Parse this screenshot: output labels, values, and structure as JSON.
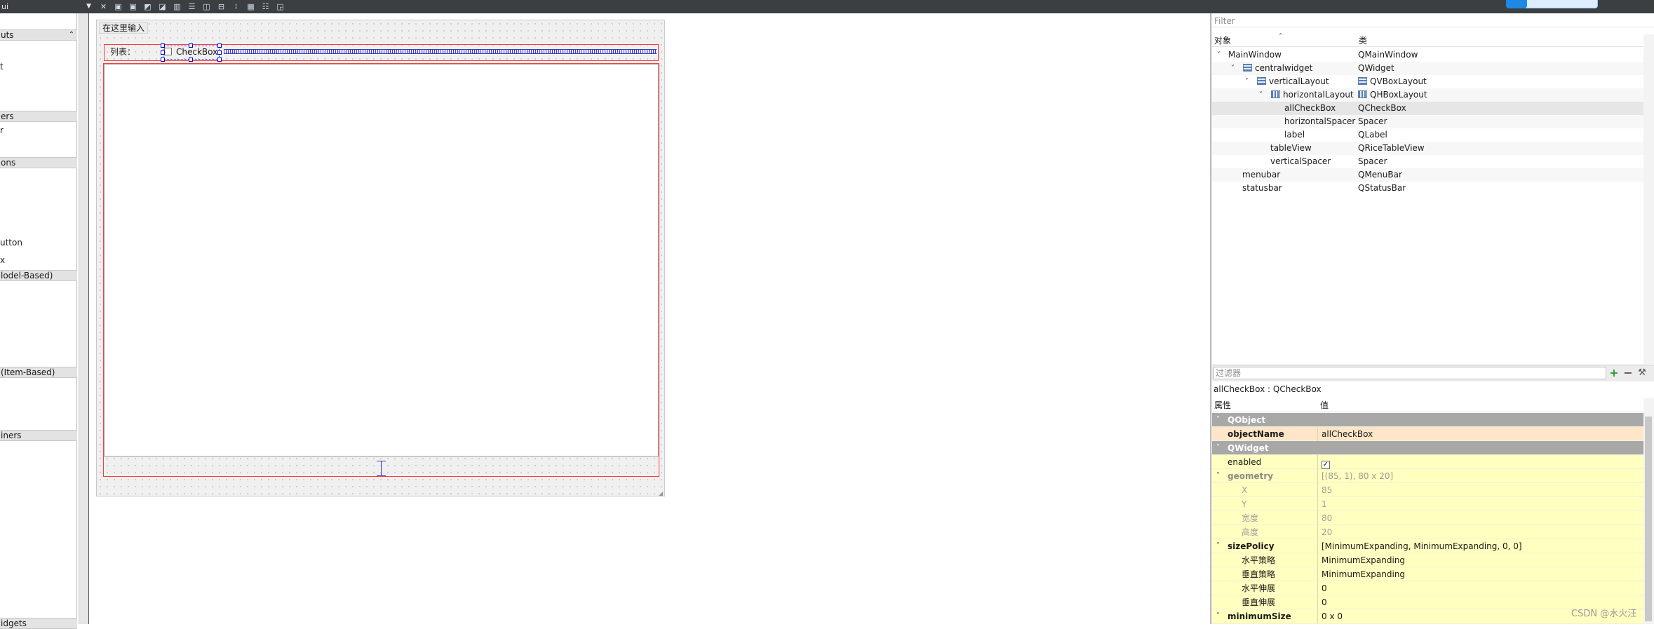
{
  "toolbar": {
    "combo_value": "ui",
    "icons": [
      "close-icon",
      "send-backward-icon",
      "bring-forward-icon",
      "edit-tab-order-icon",
      "edit-buddies-icon",
      "layout-horizontal-icon",
      "layout-vertical-icon",
      "layout-horizontal-splitter-icon",
      "layout-vertical-splitter-icon",
      "layout-grid-icon",
      "layout-form-icon",
      "break-layout-icon",
      "adjust-size-icon"
    ]
  },
  "widget_box": {
    "categories": [
      {
        "label": "uts"
      },
      {
        "label": "ers"
      },
      {
        "label": "ons"
      },
      {
        "label": "lodel-Based)"
      },
      {
        "label": "(Item-Based)"
      },
      {
        "label": "iners"
      },
      {
        "label": "idgets"
      }
    ],
    "items": [
      "t",
      "r",
      "utton",
      "x"
    ]
  },
  "form": {
    "menu_placeholder": "在这里输入",
    "label_text": "列表：",
    "checkbox_text": "CheckBox"
  },
  "object_inspector": {
    "filter_placeholder": "Filter",
    "col_object": "对象",
    "col_class": "类",
    "rows": [
      {
        "name": "MainWindow",
        "cls": "QMainWindow"
      },
      {
        "name": "centralwidget",
        "cls": "QWidget"
      },
      {
        "name": "verticalLayout",
        "cls": "QVBoxLayout"
      },
      {
        "name": "horizontalLayout",
        "cls": "QHBoxLayout"
      },
      {
        "name": "allCheckBox",
        "cls": "QCheckBox"
      },
      {
        "name": "horizontalSpacer",
        "cls": "Spacer"
      },
      {
        "name": "label",
        "cls": "QLabel"
      },
      {
        "name": "tableView",
        "cls": "QRiceTableView"
      },
      {
        "name": "verticalSpacer",
        "cls": "Spacer"
      },
      {
        "name": "menubar",
        "cls": "QMenuBar"
      },
      {
        "name": "statusbar",
        "cls": "QStatusBar"
      }
    ]
  },
  "property_editor": {
    "filter_placeholder": "过滤器",
    "caption": "allCheckBox : QCheckBox",
    "col_property": "属性",
    "col_value": "值",
    "rows": [
      {
        "name": "QObject",
        "value": ""
      },
      {
        "name": "objectName",
        "value": "allCheckBox"
      },
      {
        "name": "QWidget",
        "value": ""
      },
      {
        "name": "enabled",
        "value": "✓"
      },
      {
        "name": "geometry",
        "value": "[(85, 1), 80 x 20]"
      },
      {
        "name": "X",
        "value": "85"
      },
      {
        "name": "Y",
        "value": "1"
      },
      {
        "name": "宽度",
        "value": "80"
      },
      {
        "name": "高度",
        "value": "20"
      },
      {
        "name": "sizePolicy",
        "value": "[MinimumExpanding, MinimumExpanding, 0, 0]"
      },
      {
        "name": "水平策略",
        "value": "MinimumExpanding"
      },
      {
        "name": "垂直策略",
        "value": "MinimumExpanding"
      },
      {
        "name": "水平伸展",
        "value": "0"
      },
      {
        "name": "垂直伸展",
        "value": "0"
      },
      {
        "name": "minimumSize",
        "value": "0 x 0"
      }
    ]
  },
  "watermark": "CSDN @水火汪",
  "colors": {
    "layout_border": "#ff3b3b",
    "selection_handle": "#0000cc",
    "property_bg": "#ffffbf",
    "group_header": "#a8a8a8",
    "highlight_row": "#ffe6c8"
  }
}
